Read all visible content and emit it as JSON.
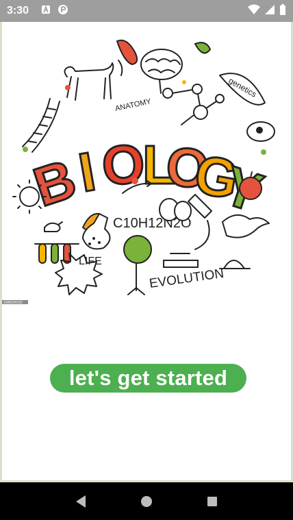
{
  "status_bar": {
    "time": "3:30",
    "left_icons": [
      "a-icon",
      "pocket-app-icon"
    ],
    "right_icons": [
      "wifi-icon",
      "cell-signal-icon",
      "battery-icon"
    ]
  },
  "hero": {
    "title_letters": [
      "B",
      "I",
      "O",
      "L",
      "O",
      "G",
      "Y"
    ],
    "letter_colors": [
      "#e5533c",
      "#f1a31c",
      "#e7402a",
      "#f5b600",
      "#ed6a3a",
      "#f3a100",
      "#7bb23a"
    ],
    "labels": {
      "anatomy": "ANATOMY",
      "genetics": "genetics",
      "formula": "C10H12N2O",
      "life": "LIFE",
      "evolution": "EVOLUTION"
    },
    "watermark_id": "1085634150"
  },
  "cta": {
    "label": "let's get started",
    "color": "#4caf50"
  },
  "nav_bar": {
    "buttons": [
      "back-icon",
      "home-icon",
      "recents-icon"
    ]
  }
}
